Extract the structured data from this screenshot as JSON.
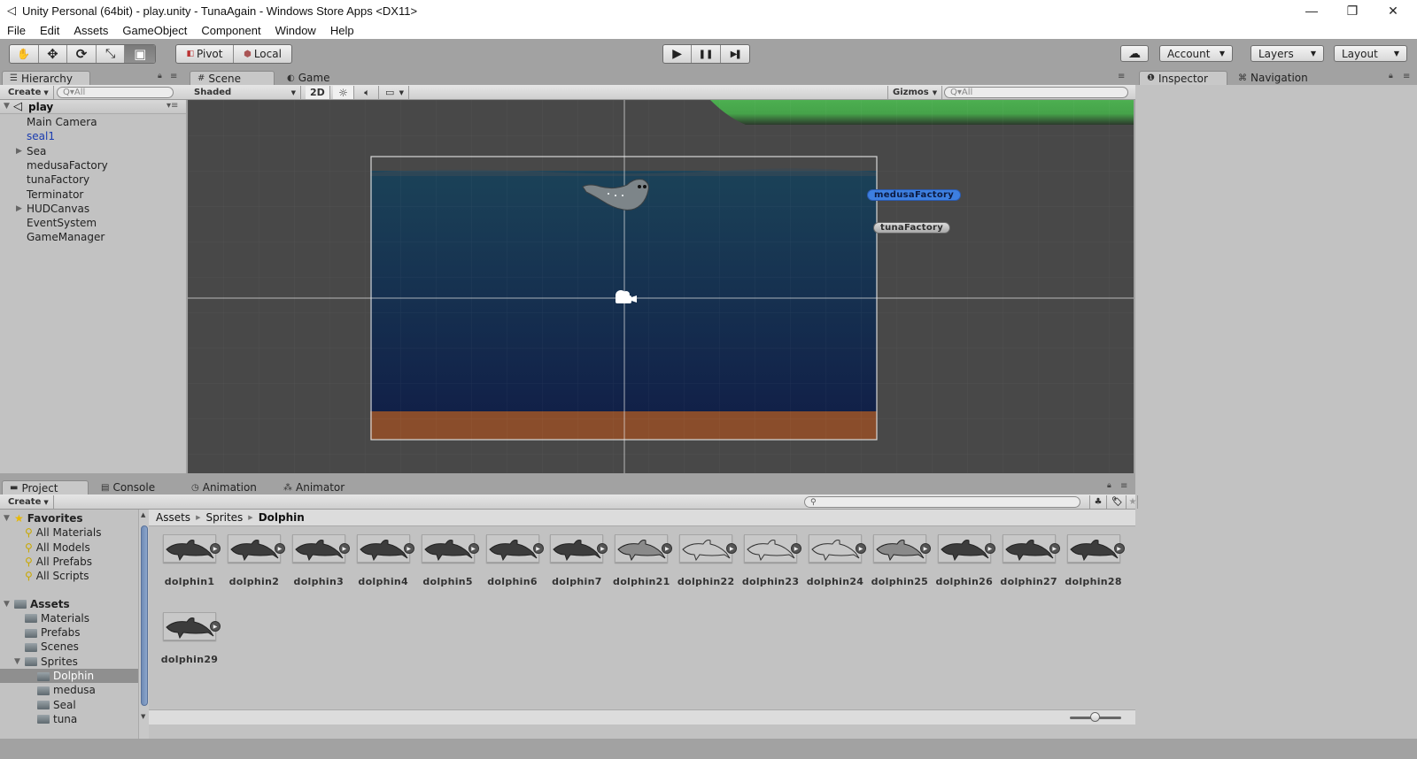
{
  "window": {
    "title": "Unity Personal (64bit) - play.unity - TunaAgain - Windows Store Apps <DX11>",
    "minimize_glyph": "—",
    "maximize_glyph": "❐",
    "close_glyph": "✕"
  },
  "menu": [
    "File",
    "Edit",
    "Assets",
    "GameObject",
    "Component",
    "Window",
    "Help"
  ],
  "toolbar": {
    "tools": [
      {
        "name": "hand-tool",
        "glyph": "✋"
      },
      {
        "name": "move-tool",
        "glyph": "✥"
      },
      {
        "name": "rotate-tool",
        "glyph": "⟳"
      },
      {
        "name": "scale-tool",
        "glyph": "⤡"
      },
      {
        "name": "rect-tool",
        "glyph": "▣"
      }
    ],
    "active_tool": "rect-tool",
    "pivot_label": "Pivot",
    "local_label": "Local",
    "play_glyph": "▶",
    "pause_glyph": "❚❚",
    "step_glyph": "▶❚",
    "cloud_glyph": "☁",
    "account_label": "Account",
    "layers_label": "Layers",
    "layout_label": "Layout"
  },
  "hierarchy": {
    "tab_label": "Hierarchy",
    "create_label": "Create",
    "search_placeholder": "Q▾All",
    "scene_name": "play",
    "items": [
      {
        "label": "Main Camera",
        "expandable": false,
        "selected": false
      },
      {
        "label": "seal1",
        "expandable": false,
        "selected": true
      },
      {
        "label": "Sea",
        "expandable": true,
        "selected": false
      },
      {
        "label": "medusaFactory",
        "expandable": false,
        "selected": false
      },
      {
        "label": "tunaFactory",
        "expandable": false,
        "selected": false
      },
      {
        "label": "Terminator",
        "expandable": false,
        "selected": false
      },
      {
        "label": "HUDCanvas",
        "expandable": true,
        "selected": false
      },
      {
        "label": "EventSystem",
        "expandable": false,
        "selected": false
      },
      {
        "label": "GameManager",
        "expandable": false,
        "selected": false
      }
    ]
  },
  "scene_view": {
    "tabs": [
      {
        "label": "Scene",
        "icon": "#",
        "active": true
      },
      {
        "label": "Game",
        "icon": "◐",
        "active": false
      }
    ],
    "shading_mode": "Shaded",
    "mode_2d_label": "2D",
    "gizmos_label": "Gizmos",
    "search_placeholder": "Q▾All",
    "object_labels": [
      {
        "label": "medusaFactory",
        "selected": true
      },
      {
        "label": "tunaFactory",
        "selected": false
      }
    ]
  },
  "inspector": {
    "tabs": [
      {
        "label": "Inspector",
        "icon": "❶",
        "active": true
      },
      {
        "label": "Navigation",
        "icon": "⌘",
        "active": false
      }
    ]
  },
  "project": {
    "tabs": [
      {
        "label": "Project",
        "icon": "▬",
        "active": true
      },
      {
        "label": "Console",
        "icon": "▤",
        "active": false
      },
      {
        "label": "Animation",
        "icon": "◷",
        "active": false
      },
      {
        "label": "Animator",
        "icon": "⁂",
        "active": false
      }
    ],
    "create_label": "Create",
    "search_placeholder": "",
    "favorites": {
      "label": "Favorites",
      "items": [
        "All Materials",
        "All Models",
        "All Prefabs",
        "All Scripts"
      ]
    },
    "assets": {
      "label": "Assets",
      "folders": [
        {
          "label": "Materials",
          "depth": 1,
          "expanded": false,
          "selected": false
        },
        {
          "label": "Prefabs",
          "depth": 1,
          "expanded": false,
          "selected": false
        },
        {
          "label": "Scenes",
          "depth": 1,
          "expanded": false,
          "selected": false
        },
        {
          "label": "Sprites",
          "depth": 1,
          "expanded": true,
          "selected": false
        },
        {
          "label": "Dolphin",
          "depth": 2,
          "expanded": false,
          "selected": true
        },
        {
          "label": "medusa",
          "depth": 2,
          "expanded": false,
          "selected": false
        },
        {
          "label": "Seal",
          "depth": 2,
          "expanded": false,
          "selected": false
        },
        {
          "label": "tuna",
          "depth": 2,
          "expanded": false,
          "selected": false
        }
      ]
    },
    "breadcrumb": [
      "Assets",
      "Sprites",
      "Dolphin"
    ],
    "files": [
      {
        "name": "dolphin1",
        "style": "dark"
      },
      {
        "name": "dolphin2",
        "style": "dark"
      },
      {
        "name": "dolphin3",
        "style": "dark"
      },
      {
        "name": "dolphin4",
        "style": "dark"
      },
      {
        "name": "dolphin5",
        "style": "dark"
      },
      {
        "name": "dolphin6",
        "style": "dark"
      },
      {
        "name": "dolphin7",
        "style": "dark"
      },
      {
        "name": "dolphin21",
        "style": "half"
      },
      {
        "name": "dolphin22",
        "style": "outline"
      },
      {
        "name": "dolphin23",
        "style": "outline"
      },
      {
        "name": "dolphin24",
        "style": "outline"
      },
      {
        "name": "dolphin25",
        "style": "half"
      },
      {
        "name": "dolphin26",
        "style": "dark"
      },
      {
        "name": "dolphin27",
        "style": "dark"
      },
      {
        "name": "dolphin28",
        "style": "dark"
      },
      {
        "name": "dolphin29",
        "style": "dark"
      }
    ],
    "thumbnail_size": 0.5
  },
  "colors": {
    "selected_text": "#1a3cb0",
    "badge_selected": "#3d7fe0",
    "sea_top": "#1b4258",
    "sea_bottom": "#112048",
    "sand": "#8a4d2b",
    "ground_green": "#4caf50"
  }
}
